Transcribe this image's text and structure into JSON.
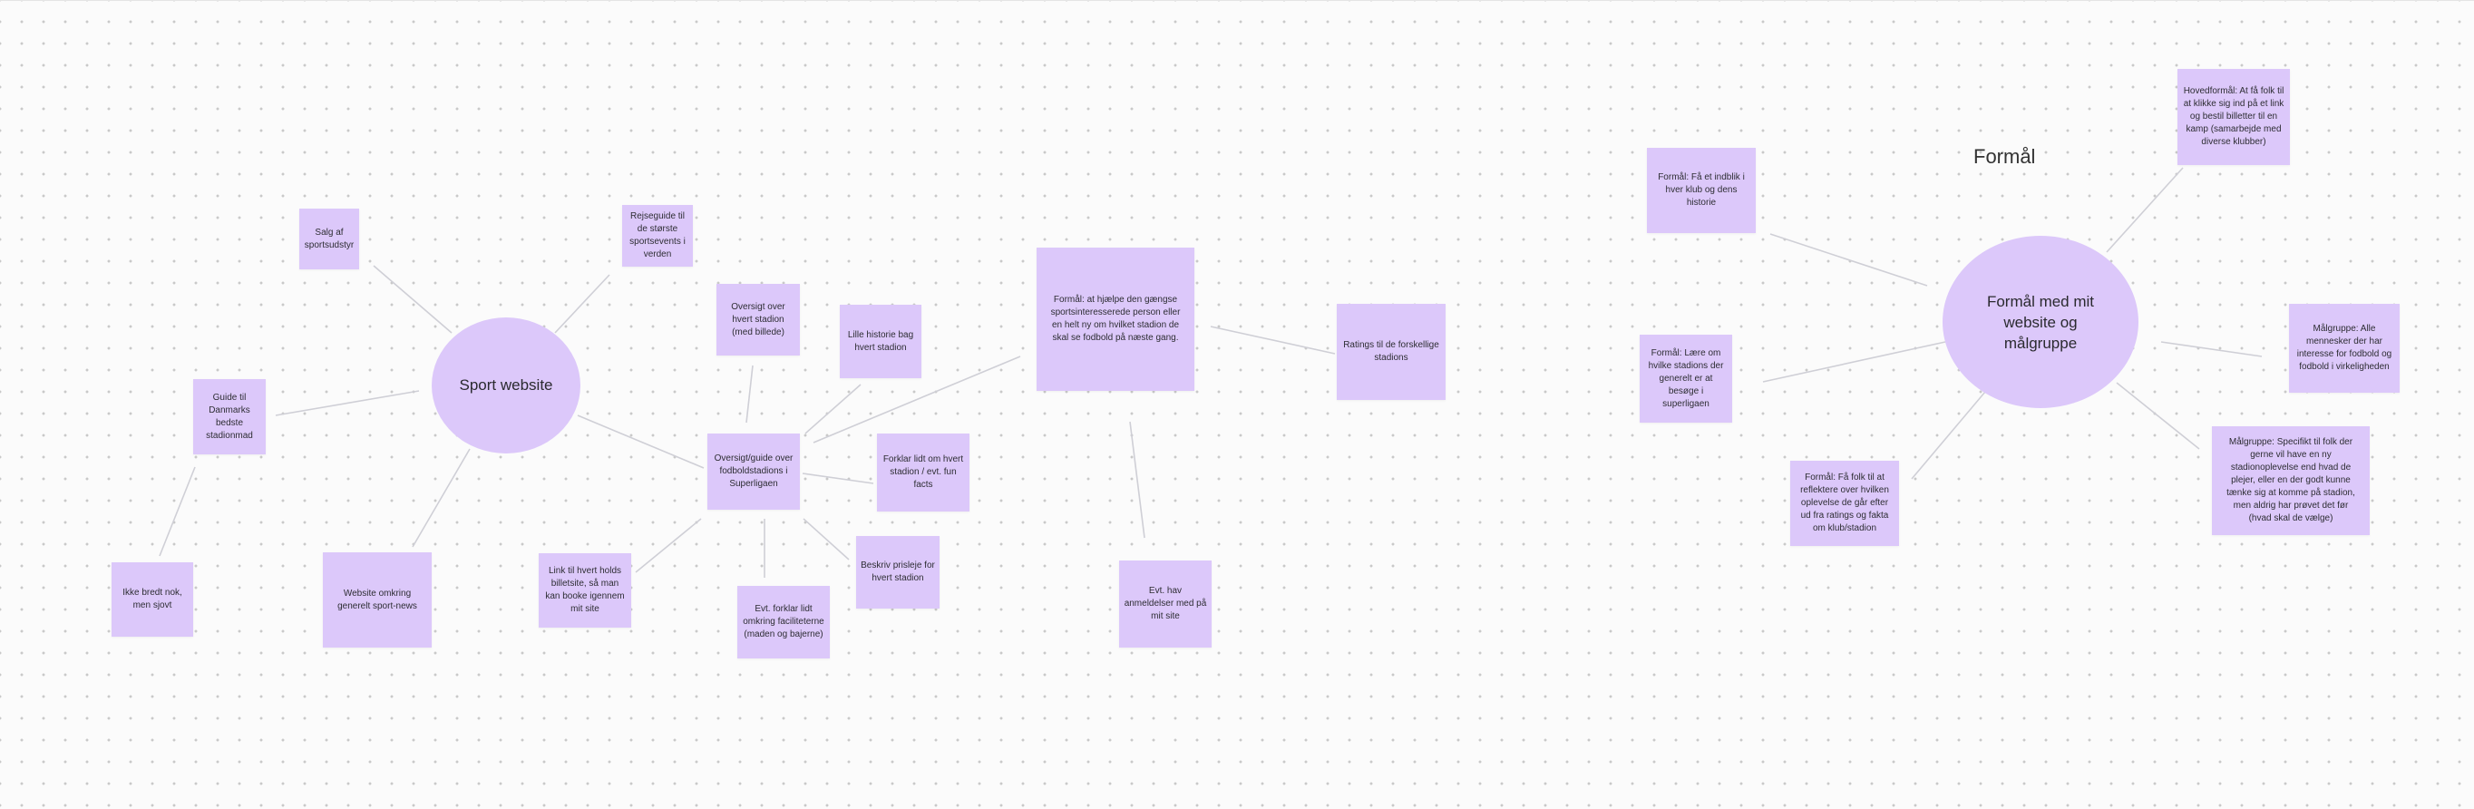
{
  "board": {
    "heading": "Formål"
  },
  "bubbles": {
    "sport_website": "Sport website",
    "formaal": "Formål med mit website og målgruppe"
  },
  "notes": {
    "salg": "Salg af sportsudstyr",
    "rejseguide": "Rejseguide til de største sportsevents i verden",
    "guide_dk": "Guide til Danmarks bedste stadionmad",
    "ikke_bredt": "Ikke bredt nok, men sjovt",
    "website_news": "Website omkring generelt sport-news",
    "link_billet": "Link til hvert holds billetsite, så man kan booke igennem mit site",
    "oversigt_stadion": "Oversigt over hvert stadion (med billede)",
    "lille_historie": "Lille historie bag hvert stadion",
    "oversigt_guide": "Oversigt/guide over fodboldstadions i Superligaen",
    "forklar_fun": "Forklar lidt om hvert stadion / evt. fun facts",
    "beskriv_pris": "Beskriv prisleje for hvert stadion",
    "evt_faciliteter": "Evt. forklar lidt omkring faciliteterne (maden og bajerne)",
    "formaal_hjaelpe": "Formål: at hjælpe den gængse sportsinteresserede person eller en helt ny om hvilket stadion de skal se fodbold på næste gang.",
    "ratings": "Ratings til de forskellige stadions",
    "evt_anmeldelser": "Evt. hav anmeldelser med på mit site",
    "formaal_indblik": "Formål: Få et indblik i hver klub og dens historie",
    "formaal_laere": "Formål: Lære om hvilke stadions der generelt er at besøge i superligaen",
    "formaal_reflektere": "Formål: Få folk til at reflektere over hvilken oplevelse de går efter ud fra ratings og fakta om klub/stadion",
    "hovedformaal": "Hovedformål: At få folk til at klikke sig ind på et link og bestil billetter til en kamp (samarbejde med diverse klubber)",
    "maalgruppe_alle": "Målgruppe: Alle mennesker der har interesse for fodbold og fodbold i virkeligheden",
    "maalgruppe_specifikt": "Målgruppe: Specifikt til folk der gerne vil have en ny stadionoplevelse end hvad de plejer, eller en der godt kunne tænke sig at komme på stadion, men aldrig har prøvet det før (hvad skal de vælge)"
  }
}
